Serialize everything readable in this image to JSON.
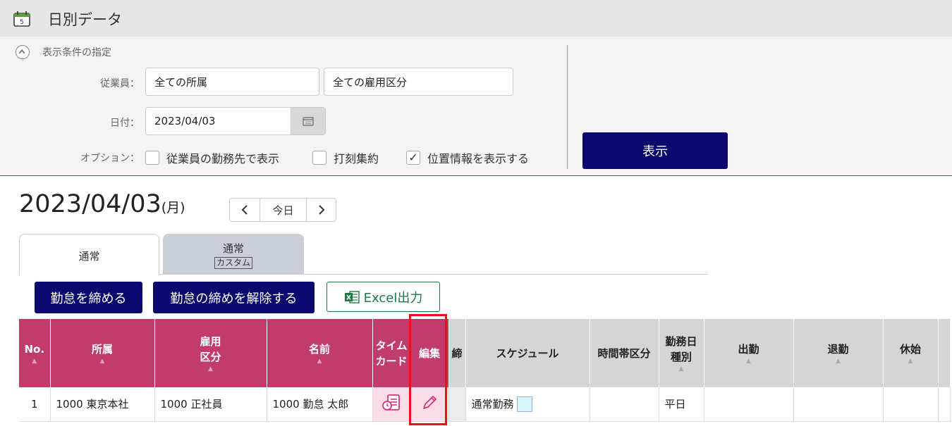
{
  "page": {
    "title": "日別データ"
  },
  "conditions": {
    "toggle_label": "表示条件の指定",
    "employee_label": "従業員：",
    "affiliation_value": "全ての所属",
    "employment_value": "全ての雇用区分",
    "date_label": "日付：",
    "date_value": "2023/04/03",
    "option_label": "オプション：",
    "options": [
      {
        "label": "従業員の勤務先で表示",
        "checked": false
      },
      {
        "label": "打刻集約",
        "checked": false
      },
      {
        "label": "位置情報を表示する",
        "checked": true
      }
    ],
    "show_button": "表示"
  },
  "day_header": {
    "date": "2023/04/03",
    "weekday": "(月)",
    "prev": "‹",
    "today": "今日",
    "next": "›"
  },
  "tabs": [
    {
      "label": "通常",
      "active": true
    },
    {
      "label": "通常",
      "tag": "カスタム",
      "active": false
    }
  ],
  "actions": {
    "close_attendance": "勤怠を締める",
    "unclose_attendance": "勤怠の締めを解除する",
    "excel_export": "Excel出力"
  },
  "table": {
    "headers": {
      "no": "No.",
      "affiliation": "所属",
      "employment_1": "雇用",
      "employment_2": "区分",
      "name": "名前",
      "timecard_1": "タイム",
      "timecard_2": "カード",
      "edit": "編集",
      "lock": "締",
      "schedule": "スケジュール",
      "time_zone": "時間帯区分",
      "daytype_1": "勤務日",
      "daytype_2": "種別",
      "clock_in": "出勤",
      "clock_out": "退勤",
      "break_start": "休始"
    },
    "rows": [
      {
        "no": "1",
        "affiliation": "1000 東京本社",
        "employment": "1000 正社員",
        "name": "1000 勤怠 太郎",
        "schedule": "通常勤務",
        "day_type": "平日"
      }
    ]
  },
  "colors": {
    "header_pink": "#c13c6d",
    "navy": "#0a0a6e",
    "highlight": "#e8101a",
    "excel_green": "#1e7a45"
  }
}
